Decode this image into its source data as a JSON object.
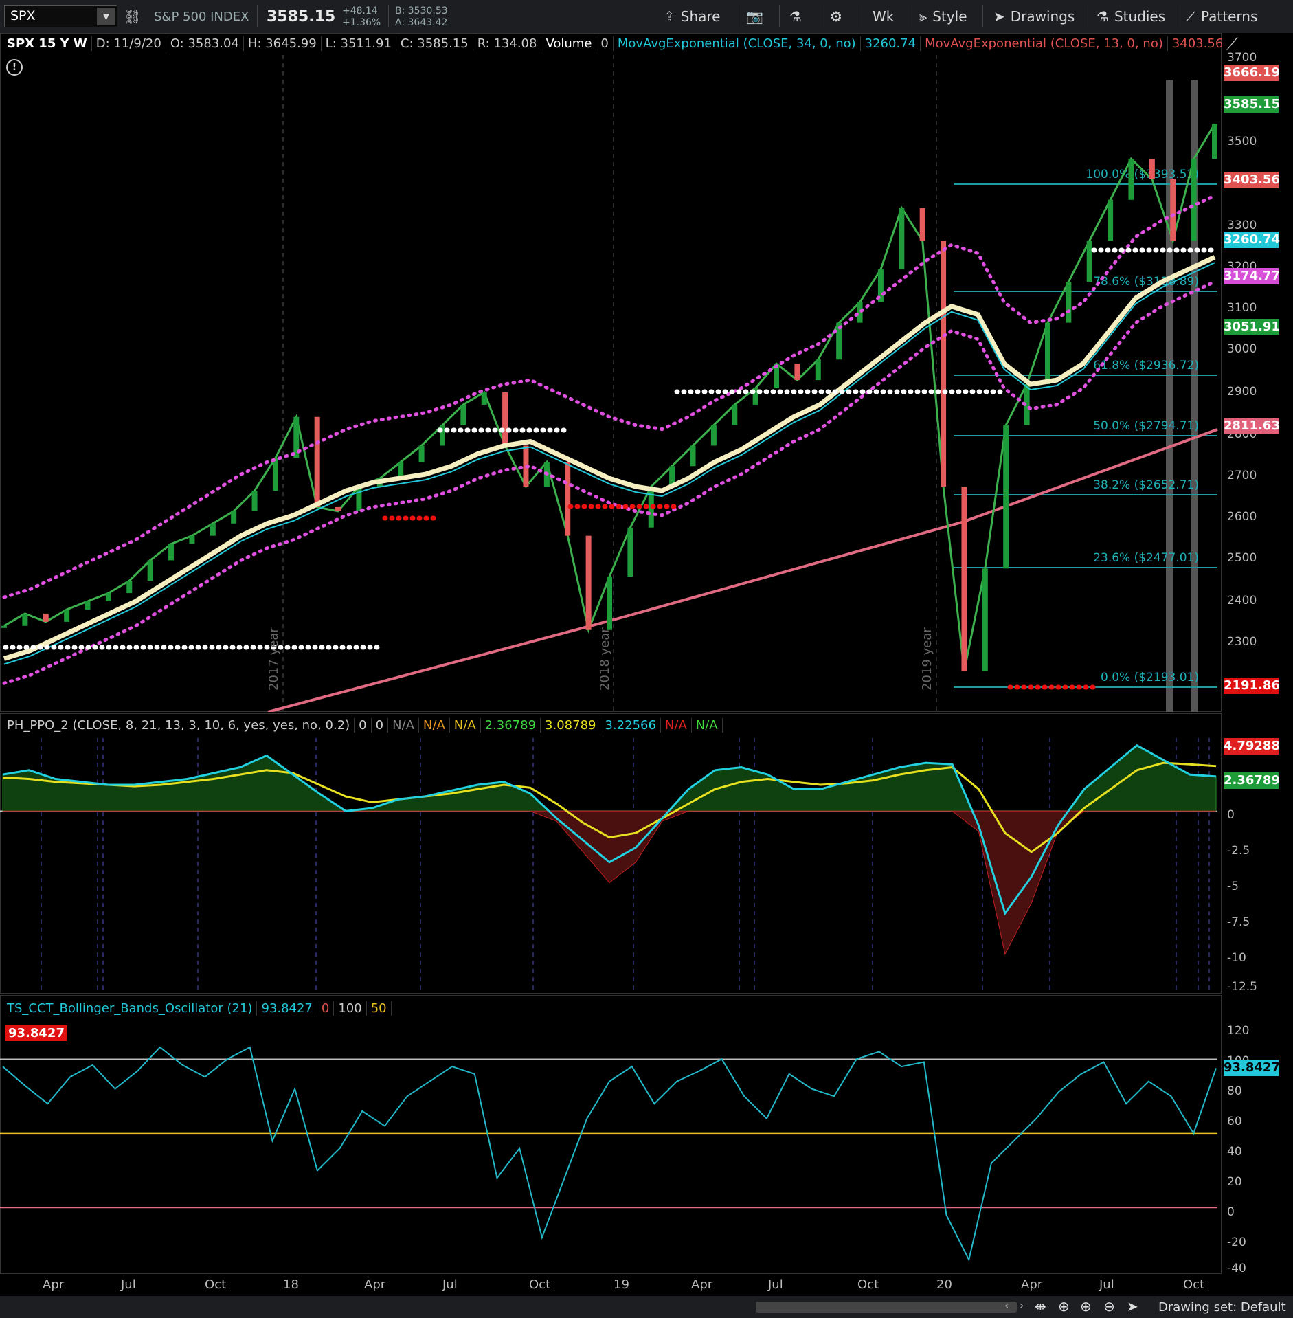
{
  "toolbar": {
    "symbol": "SPX",
    "description": "S&P 500 INDEX",
    "last": "3585.15",
    "change_abs": "+48.14",
    "change_pct": "+1.36%",
    "bid": "B: 3530.53",
    "ask": "A: 3643.42",
    "share_label": "Share",
    "timeframe_label": "Wk",
    "style_label": "Style",
    "drawings_label": "Drawings",
    "studies_label": "Studies",
    "patterns_label": "Patterns"
  },
  "price_legend": {
    "symbol": "SPX 15 Y W",
    "date": "D: 11/9/20",
    "open": "O: 3583.04",
    "high": "H: 3645.99",
    "low": "L: 3511.91",
    "close": "C: 3585.15",
    "range": "R: 134.08",
    "volume_label": "Volume",
    "volume_value": "0",
    "ema34_label": "MovAvgExponential (CLOSE, 34, 0, no)",
    "ema34_value": "3260.74",
    "ema13_label": "MovAvgExponential (CLOSE, 13, 0, no)",
    "ema13_value": "3403.56"
  },
  "price_axis": {
    "ticks": [
      "3700",
      "3500",
      "3300",
      "3200",
      "3100",
      "3000",
      "2900",
      "2800",
      "2700",
      "2600",
      "2500",
      "2400",
      "2300"
    ],
    "tags": [
      {
        "label": "3666.19",
        "color": "#e05252"
      },
      {
        "label": "3585.15",
        "color": "#1e9c3a"
      },
      {
        "label": "3403.56",
        "color": "#e05252"
      },
      {
        "label": "3260.74",
        "color": "#22c7d8"
      },
      {
        "label": "3174.77",
        "color": "#d64fd6"
      },
      {
        "label": "3051.91",
        "color": "#1e9c3a"
      },
      {
        "label": "2811.63",
        "color": "#e0607a"
      },
      {
        "label": "2191.86",
        "color": "#e01010"
      }
    ]
  },
  "fib_labels": [
    "100.0% ($3393.52)",
    "78.6% ($3138.89)",
    "61.8% ($2936.72)",
    "50.0% ($2794.71)",
    "38.2% ($2652.71)",
    "23.6% ($2477.01)",
    "0.0% ($2193.01)"
  ],
  "year_labels": [
    "2017 year",
    "2018 year",
    "2019 year"
  ],
  "ppo_legend": {
    "name": "PH_PPO_2 (CLOSE, 8, 21, 13, 3, 10, 6, yes, yes, no, 0.2)",
    "v1": "0",
    "v2": "0",
    "v3": "N/A",
    "v4": "N/A",
    "v5": "N/A",
    "v6": "2.36789",
    "v7": "3.08789",
    "v8": "3.22566",
    "v9": "N/A",
    "v10": "N/A"
  },
  "ppo_axis": {
    "ticks": [
      "0",
      "-2.5",
      "-5",
      "-7.5",
      "-10",
      "-12.5"
    ],
    "tag_top": "4.79288",
    "tag_cur": "2.36789"
  },
  "bbo_legend": {
    "name": "TS_CCT_Bollinger_Bands_Oscillator (21)",
    "value": "93.8427",
    "v2": "0",
    "v3": "100",
    "v4": "50",
    "badge": "93.8427"
  },
  "bbo_axis": {
    "ticks": [
      "120",
      "100",
      "80",
      "60",
      "40",
      "20",
      "0",
      "-20",
      "-40"
    ],
    "tag": "93.8427"
  },
  "x_axis": [
    "Apr",
    "Jul",
    "Oct",
    "18",
    "Apr",
    "Jul",
    "Oct",
    "19",
    "Apr",
    "Jul",
    "Oct",
    "20",
    "Apr",
    "Jul",
    "Oct"
  ],
  "bottom": {
    "drawing_set": "Drawing set: Default"
  },
  "colors": {
    "ema34": "#22c7d8",
    "ema13": "#e05252",
    "ppo_fast": "#22d0e0",
    "ppo_slow": "#e6e020",
    "bbo": "#22b8c8"
  },
  "chart_data": [
    {
      "type": "line",
      "title": "SPX 15 Y W",
      "series": [
        {
          "name": "SPX",
          "values": [
            2360,
            2390,
            2370,
            2400,
            2420,
            2440,
            2470,
            2520,
            2560,
            2580,
            2610,
            2640,
            2690,
            2770,
            2870,
            2650,
            2640,
            2700,
            2720,
            2760,
            2800,
            2850,
            2900,
            2930,
            2800,
            2700,
            2760,
            2580,
            2350,
            2480,
            2600,
            2700,
            2750,
            2800,
            2850,
            2900,
            2940,
            3000,
            2960,
            3010,
            3100,
            3150,
            3230,
            3380,
            3300,
            2700,
            2250,
            2500,
            2850,
            2950,
            3100,
            3200,
            3300,
            3400,
            3500,
            3450,
            3300,
            3500,
            3585
          ]
        },
        {
          "name": "MovAvgExponential (CLOSE, 34, 0, no)",
          "values": [
            2280,
            2300,
            2330,
            2360,
            2390,
            2420,
            2460,
            2500,
            2540,
            2580,
            2610,
            2630,
            2660,
            2690,
            2710,
            2720,
            2730,
            2750,
            2780,
            2800,
            2810,
            2780,
            2750,
            2720,
            2700,
            2690,
            2720,
            2760,
            2790,
            2830,
            2870,
            2900,
            2950,
            3000,
            3050,
            3100,
            3140,
            3120,
            3000,
            2950,
            2960,
            3000,
            3080,
            3160,
            3200,
            3230,
            3260
          ]
        }
      ]
    },
    {
      "type": "line",
      "title": "PH_PPO_2 (CLOSE, 8, 21, 13, 3, 10, 6, yes, yes, no, 0.2)",
      "ylim": [
        -12.5,
        5
      ],
      "series": [
        {
          "name": "fast",
          "values": [
            2.5,
            2.8,
            2.2,
            2.0,
            1.8,
            1.8,
            2.0,
            2.2,
            2.6,
            3.0,
            3.8,
            2.5,
            1.2,
            0.0,
            0.2,
            0.8,
            1.0,
            1.4,
            1.8,
            2.0,
            1.2,
            -0.5,
            -2.0,
            -3.5,
            -2.5,
            -0.5,
            1.5,
            2.8,
            3.0,
            2.5,
            1.5,
            1.5,
            2.0,
            2.5,
            3.0,
            3.3,
            3.2,
            -1.0,
            -7.0,
            -4.5,
            -1.0,
            1.5,
            3.0,
            4.5,
            3.5,
            2.5,
            2.37
          ]
        },
        {
          "name": "slow",
          "values": [
            2.3,
            2.2,
            2.0,
            1.9,
            1.8,
            1.7,
            1.8,
            2.0,
            2.2,
            2.5,
            2.8,
            2.6,
            1.8,
            1.0,
            0.6,
            0.8,
            1.0,
            1.2,
            1.5,
            1.8,
            1.6,
            0.5,
            -0.8,
            -1.8,
            -1.5,
            -0.5,
            0.5,
            1.5,
            2.0,
            2.2,
            2.0,
            1.8,
            1.9,
            2.1,
            2.5,
            2.8,
            3.0,
            1.5,
            -1.5,
            -2.8,
            -1.5,
            0.2,
            1.5,
            2.8,
            3.3,
            3.2,
            3.08
          ]
        }
      ]
    },
    {
      "type": "line",
      "title": "TS_CCT_Bollinger_Bands_Oscillator (21)",
      "ylim": [
        -40,
        120
      ],
      "series": [
        {
          "name": "BBO",
          "values": [
            95,
            82,
            70,
            88,
            96,
            80,
            92,
            108,
            96,
            88,
            100,
            108,
            45,
            80,
            25,
            40,
            65,
            55,
            75,
            85,
            95,
            90,
            20,
            40,
            -20,
            20,
            60,
            85,
            95,
            70,
            85,
            92,
            100,
            75,
            60,
            90,
            80,
            75,
            100,
            105,
            95,
            98,
            -5,
            -35,
            30,
            45,
            60,
            78,
            90,
            98,
            70,
            85,
            75,
            50,
            93.84
          ]
        }
      ]
    }
  ]
}
